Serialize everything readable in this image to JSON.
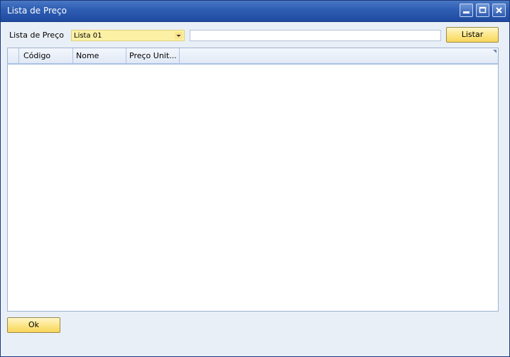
{
  "window": {
    "title": "Lista de Preço",
    "buttons": [
      "minimize",
      "maximize",
      "close"
    ]
  },
  "form": {
    "price_list_label": "Lista de Preço",
    "price_list_value": "Lista 01",
    "text_value": "",
    "list_button": "Listar"
  },
  "grid": {
    "columns": [
      "",
      "Código",
      "Nome",
      "Preço Unit..."
    ],
    "rows": []
  },
  "footer": {
    "ok_button": "Ok"
  },
  "colors": {
    "titlebar": "#2f5fb4",
    "combo_bg": "#fcf0a4",
    "button_bg": "#fce68a",
    "window_bg": "#e9eff7"
  }
}
